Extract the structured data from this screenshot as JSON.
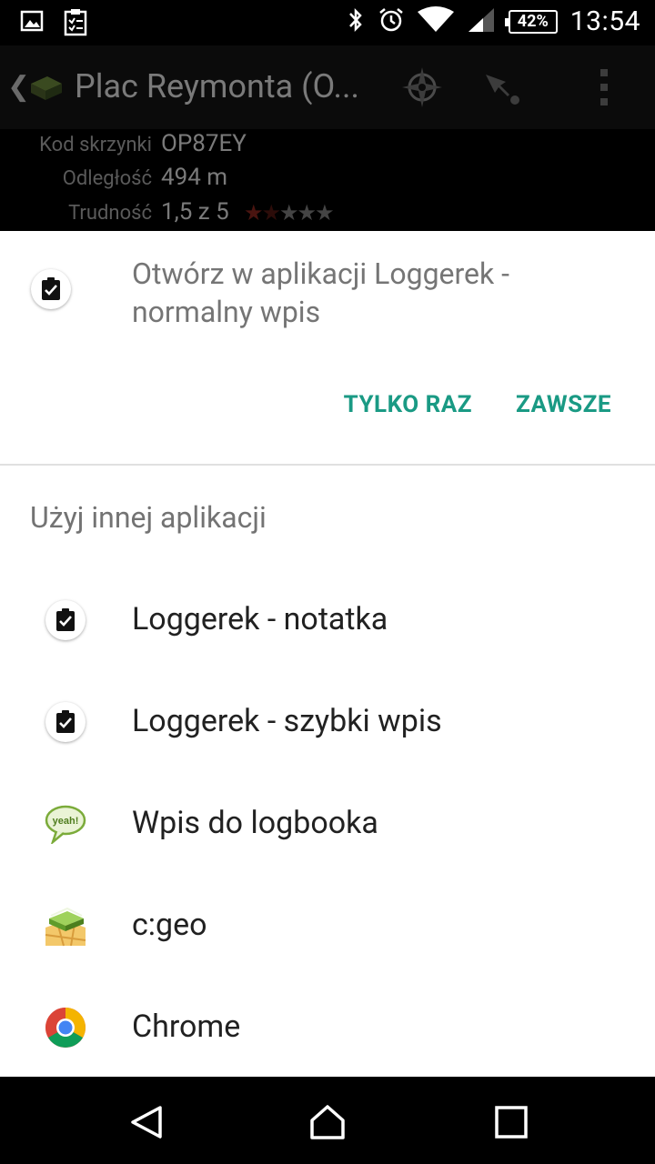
{
  "status_bar": {
    "battery": "42%",
    "time": "13:54",
    "icons": [
      "image-icon",
      "clipboard-list-icon",
      "bluetooth-icon",
      "alarm-icon",
      "wifi-icon",
      "signal-icon",
      "battery-icon"
    ]
  },
  "background_app": {
    "title": "Plac Reymonta (O...",
    "details": [
      {
        "label": "Kod skrzynki",
        "value": "OP87EY"
      },
      {
        "label": "Odległość",
        "value": "494 m"
      },
      {
        "label": "Trudność",
        "value": "1,5 z 5"
      }
    ],
    "difficulty_rating": 1.5,
    "difficulty_max": 5,
    "icons": [
      "back-chevron-icon",
      "cgeo-logo-icon",
      "compass-icon",
      "navigate-arrow-icon",
      "overflow-menu-icon"
    ]
  },
  "chooser": {
    "default_app_label": "Otwórz w aplikacji Loggerek - normalny wpis",
    "once_button": "TYLKO RAZ",
    "always_button": "ZAWSZE",
    "other_apps_header": "Użyj innej aplikacji",
    "apps": [
      {
        "label": "Loggerek - notatka",
        "icon": "loggerek-clipboard-icon"
      },
      {
        "label": "Loggerek - szybki wpis",
        "icon": "loggerek-clipboard-icon"
      },
      {
        "label": "Wpis do logbooka",
        "icon": "yeah-speech-bubble-icon"
      },
      {
        "label": "c:geo",
        "icon": "cgeo-map-icon"
      },
      {
        "label": "Chrome",
        "icon": "chrome-icon"
      }
    ],
    "accent_color": "#1a9a84"
  },
  "nav_bar": {
    "icons": [
      "back-triangle-icon",
      "home-icon",
      "recents-square-icon"
    ]
  }
}
